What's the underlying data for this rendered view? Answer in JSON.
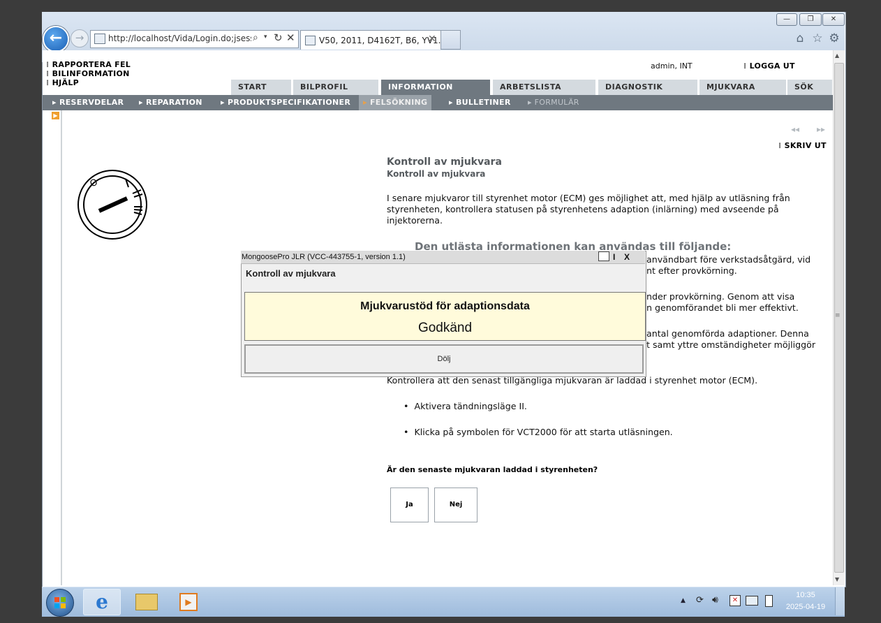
{
  "browser": {
    "url": "http://localhost/Vida/Login.do;jsessio",
    "tab_title": "V50, 2011, D4162T, B6, YV1...",
    "window_buttons": [
      "—",
      "❐",
      "✕"
    ]
  },
  "page": {
    "top_menu": [
      "RAPPORTERA FEL",
      "BILINFORMATION",
      "HJÄLP"
    ],
    "user": "admin, INT",
    "logout": "LOGGA UT",
    "tabs": [
      "START",
      "BILPROFIL",
      "INFORMATION",
      "ARBETSLISTA",
      "DIAGNOSTIK",
      "MJUKVARA",
      "SÖK"
    ],
    "active_tab": "INFORMATION",
    "subnav": [
      "RESERVDELAR",
      "REPARATION",
      "PRODUKTSPECIFIKATIONER",
      "FELSÖKNING",
      "BULLETINER",
      "FORMULÄR"
    ],
    "active_subnav": "FELSÖKNING",
    "disabled_subnav": "FORMULÄR",
    "print_label": "SKRIV UT",
    "article": {
      "title": "Kontroll av mjukvara",
      "subtitle": "Kontroll av mjukvara",
      "intro": "I senare mjukvaror till styrenhet motor (ECM) ges möjlighet att, med hjälp av utläsning från styrenheten, kontrollera statusen på styrenhetens adaption (inlärning) med avseende på injektorerna.",
      "section_heading": "Den utlästa informationen kan användas till följande:",
      "fragment1_l1": "användbart före verkstadsåtgärd, vid",
      "fragment1_l2": "nt efter provkörning.",
      "fragment2_l1": "nder provkörning. Genom att visa",
      "fragment2_l2": "n genomförandet bli mer effektivt.",
      "fragment3_l1": "antal genomförda adaptioner. Denna",
      "fragment3_l2": "t samt yttre omständigheter möjliggör",
      "check_text": "Kontrollera att den senast tillgängliga mjukvaran är laddad i styrenhet motor (ECM).",
      "bullets": [
        "Aktivera tändningsläge II.",
        "Klicka på symbolen för VCT2000 för att starta utläsningen."
      ],
      "question": "Är den senaste mjukvaran laddad i styrenheten?",
      "yes": "Ja",
      "no": "Nej"
    }
  },
  "dialog": {
    "title": "MongoosePro JLR   (VCC-443755-1, version 1.1)",
    "heading": "Kontroll av mjukvara",
    "box_title": "Mjukvarustöd för adaptionsdata",
    "result": "Godkänd",
    "hide_button": "Dölj",
    "icons": {
      "info": "I",
      "close": "X"
    }
  },
  "taskbar": {
    "time": "10:35",
    "date": "2025-04-19"
  }
}
